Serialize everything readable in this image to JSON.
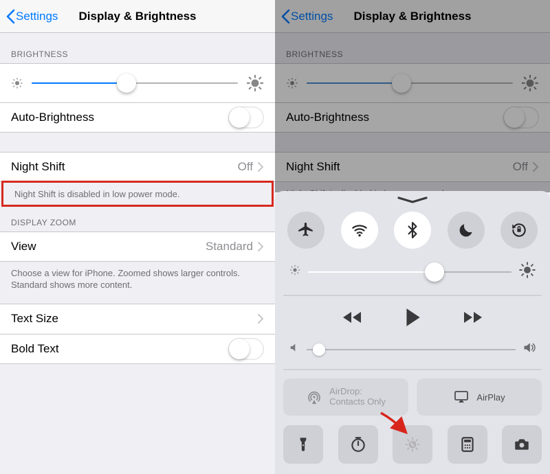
{
  "nav": {
    "back": "Settings",
    "title": "Display & Brightness"
  },
  "sections": {
    "brightness_header": "BRIGHTNESS",
    "auto_brightness": "Auto-Brightness",
    "night_shift": {
      "label": "Night Shift",
      "value": "Off"
    },
    "night_shift_note": "Night Shift is disabled in low power mode.",
    "display_zoom_header": "DISPLAY ZOOM",
    "view": {
      "label": "View",
      "value": "Standard"
    },
    "zoom_note": "Choose a view for iPhone. Zoomed shows larger controls. Standard shows more content.",
    "text_size": "Text Size",
    "bold_text": "Bold Text"
  },
  "slider": {
    "brightness_pct": 46,
    "cc_brightness_pct": 62,
    "volume_pct": 6
  },
  "control_center": {
    "airdrop": {
      "title": "AirDrop:",
      "subtitle": "Contacts Only"
    },
    "airplay": "AirPlay"
  },
  "icons": {
    "chevron_left": "chevron-left-icon",
    "chevron_right": "chevron-right-icon",
    "sun_small": "sun-low-icon",
    "sun_large": "sun-high-icon",
    "airplane": "airplane-icon",
    "wifi": "wifi-icon",
    "bluetooth": "bluetooth-icon",
    "moon": "moon-icon",
    "rotation_lock": "rotation-lock-icon",
    "rewind": "rewind-icon",
    "play": "play-icon",
    "forward": "forward-icon",
    "speaker_low": "speaker-low-icon",
    "speaker_high": "speaker-high-icon",
    "airdrop": "airdrop-icon",
    "airplay": "airplay-icon",
    "flashlight": "flashlight-icon",
    "timer": "timer-icon",
    "night_shift": "night-shift-icon",
    "calculator": "calculator-icon",
    "camera": "camera-icon"
  }
}
